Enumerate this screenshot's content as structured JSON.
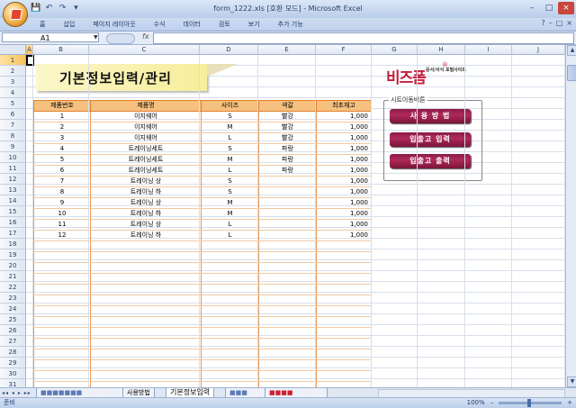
{
  "window": {
    "title": "form_1222.xls [호환 모드] - Microsoft Excel",
    "controls": [
      "–",
      "□",
      "×"
    ]
  },
  "qat": [
    "💾",
    "↶",
    "↷",
    "▾"
  ],
  "ribbon": {
    "tabs": [
      "홈",
      "삽입",
      "페이지 레이아웃",
      "수식",
      "데이터",
      "검토",
      "보기",
      "추가 기능"
    ],
    "right_icons": [
      "?",
      "–",
      "□",
      "×"
    ]
  },
  "formula_bar": {
    "name_box": "A1",
    "fx": "fx",
    "value": ""
  },
  "columns": [
    "A",
    "B",
    "C",
    "D",
    "E",
    "F",
    "G",
    "H",
    "I",
    "J"
  ],
  "rows": [
    "1",
    "2",
    "3",
    "4",
    "5",
    "6",
    "7",
    "8",
    "9",
    "10",
    "11",
    "12",
    "13",
    "14",
    "15",
    "16",
    "17",
    "18",
    "19",
    "20",
    "21",
    "22",
    "23",
    "24",
    "25",
    "26",
    "27",
    "28",
    "29",
    "30",
    "31"
  ],
  "sheet_title": "기본정보입력/관리",
  "logo": {
    "main": "비즈폼",
    "reg": "®",
    "sub": "문서/서식 포털사이트"
  },
  "panel": {
    "title": "시트이동버튼",
    "buttons": [
      "사 용 방 법",
      "입출고 입력",
      "입출고 출력"
    ]
  },
  "table": {
    "headers": [
      "제품번호",
      "제품명",
      "사이즈",
      "색갈",
      "최초재고"
    ],
    "rows": [
      [
        "1",
        "이지웨어",
        "S",
        "빨강",
        "1,000"
      ],
      [
        "2",
        "이지웨어",
        "M",
        "빨강",
        "1,000"
      ],
      [
        "3",
        "이지웨어",
        "L",
        "빨강",
        "1,000"
      ],
      [
        "4",
        "트레이닝세트",
        "S",
        "파랑",
        "1,000"
      ],
      [
        "5",
        "트레이닝세트",
        "M",
        "파랑",
        "1,000"
      ],
      [
        "6",
        "트레이닝세트",
        "L",
        "파랑",
        "1,000"
      ],
      [
        "7",
        "트레이닝 상",
        "S",
        "",
        "1,000"
      ],
      [
        "8",
        "트레이닝 하",
        "S",
        "",
        "1,000"
      ],
      [
        "9",
        "트레이닝 상",
        "M",
        "",
        "1,000"
      ],
      [
        "10",
        "트레이닝 하",
        "M",
        "",
        "1,000"
      ],
      [
        "11",
        "트레이닝 상",
        "L",
        "",
        "1,000"
      ],
      [
        "12",
        "트레이닝 하",
        "L",
        "",
        "1,000"
      ]
    ],
    "empty_rows": 14
  },
  "sheet_tabs": {
    "nav": "◂◂ ◂ ▸ ▸▸",
    "tabs": [
      "사용방법",
      "기본정보입력"
    ]
  },
  "status": {
    "left": "준비",
    "zoom": "100%",
    "minus": "–",
    "plus": "+"
  }
}
